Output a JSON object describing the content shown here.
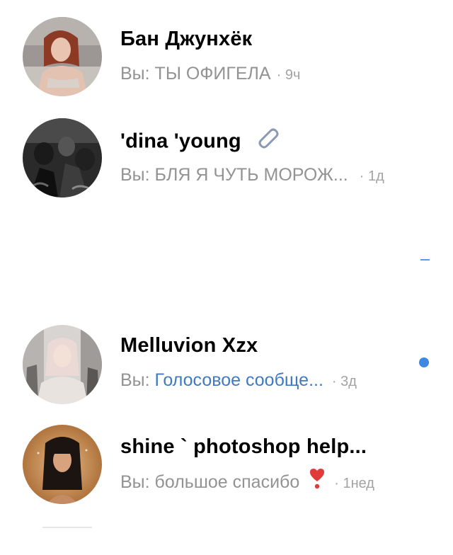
{
  "dialogs": [
    {
      "name": "Бан Джунхёк",
      "prefix": "Вы:",
      "message": "ТЫ ОФИГЕЛА",
      "time": "· 9ч",
      "avatar_icon": "avatar-photo-woman-red-hair"
    },
    {
      "name": "'dina 'young",
      "prefix": "Вы:",
      "message": "БЛЯ Я ЧУТЬ МОРОЖ...",
      "time": "· 1д",
      "attachment_icon": "paperclip-icon",
      "avatar_icon": "avatar-photo-dark-crowd"
    },
    {
      "name": "Melluvion Xzx",
      "prefix": "Вы:",
      "message": "Голосовое сообще...",
      "time": "· 3д",
      "unread": true,
      "avatar_icon": "avatar-photo-pale-hair"
    },
    {
      "name": "shine ` photoshop help...",
      "prefix": "Вы:",
      "message": "большое спасибо",
      "message_emoji_icon": "heart-exclamation-icon",
      "time": "· 1нед",
      "avatar_icon": "avatar-photo-woman-bangs"
    }
  ],
  "colors": {
    "name": "#000000",
    "secondary": "#939393",
    "link": "#3f7ac2",
    "unread_dot": "#3f87e0"
  }
}
